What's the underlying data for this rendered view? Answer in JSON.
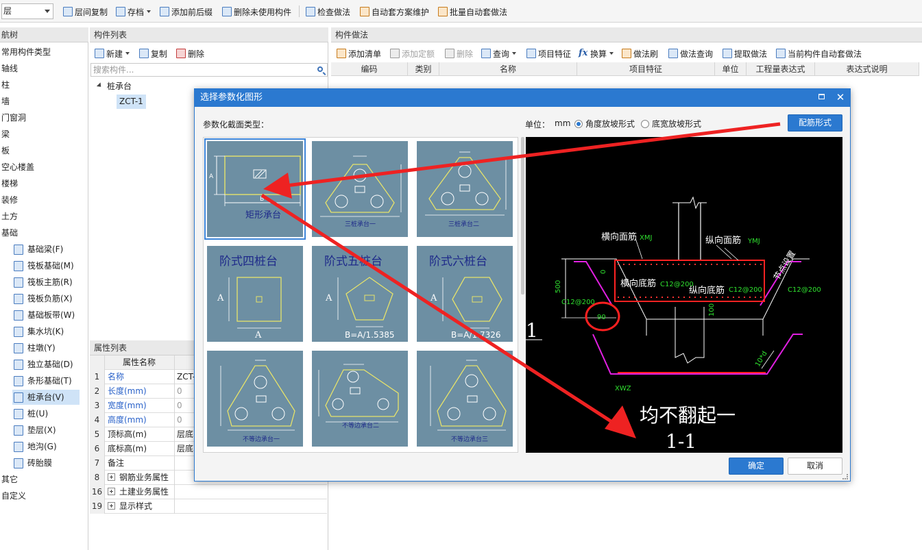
{
  "toolbar": {
    "floor": "层",
    "items": [
      "层间复制",
      "存档",
      "添加前后缀",
      "删除未使用构件",
      "检查做法",
      "自动套方案维护",
      "批量自动套做法"
    ]
  },
  "nav": {
    "title": "航树",
    "items": [
      "常用构件类型",
      "轴线",
      "柱",
      "墙",
      "门窗洞",
      "梁",
      "板",
      "空心楼盖",
      "楼梯",
      "装修",
      "土方",
      "基础"
    ],
    "sub_items": [
      "基础梁(F)",
      "筏板基础(M)",
      "筏板主筋(R)",
      "筏板负筋(X)",
      "基础板带(W)",
      "集水坑(K)",
      "柱墩(Y)",
      "独立基础(D)",
      "条形基础(T)",
      "桩承台(V)",
      "桩(U)",
      "垫层(X)",
      "地沟(G)",
      "砖胎膜"
    ],
    "bottom_items": [
      "其它",
      "自定义"
    ]
  },
  "complist": {
    "title": "构件列表",
    "new": "新建",
    "copy": "复制",
    "delete": "删除",
    "search_placeholder": "搜索构件...",
    "tree_root": "桩承台",
    "tree_child": "ZCT-1"
  },
  "props": {
    "title": "属性列表",
    "col_name": "属性名称",
    "rows": [
      {
        "num": "1",
        "name": "名称",
        "value": "ZCT-"
      },
      {
        "num": "2",
        "name": "长度(mm)",
        "value": "0"
      },
      {
        "num": "3",
        "name": "宽度(mm)",
        "value": "0"
      },
      {
        "num": "4",
        "name": "高度(mm)",
        "value": "0"
      },
      {
        "num": "5",
        "name": "顶标高(m)",
        "value": "层底"
      },
      {
        "num": "6",
        "name": "底标高(m)",
        "value": "层底"
      },
      {
        "num": "7",
        "name": "备注",
        "value": ""
      },
      {
        "num": "8",
        "name": "钢筋业务属性",
        "value": ""
      },
      {
        "num": "16",
        "name": "土建业务属性",
        "value": ""
      },
      {
        "num": "19",
        "name": "显示样式",
        "value": ""
      }
    ]
  },
  "method": {
    "title": "构件做法",
    "toolbar": [
      "添加清单",
      "添加定额",
      "删除",
      "查询",
      "项目特征",
      "换算",
      "做法刷",
      "做法查询",
      "提取做法",
      "当前构件自动套做法"
    ],
    "columns": [
      "编码",
      "类别",
      "名称",
      "项目特征",
      "单位",
      "工程量表达式",
      "表达式说明"
    ]
  },
  "dialog": {
    "title": "选择参数化图形",
    "section_label": "参数化截面类型：",
    "unit_label": "单位：",
    "unit_value": "mm",
    "radio_angle": "角度放坡形式",
    "radio_width": "底宽放坡形式",
    "rebar_button": "配筋形式",
    "ok": "确定",
    "cancel": "取消",
    "tiles": [
      {
        "label": "矩形承台",
        "kind": "rect"
      },
      {
        "label": "三桩承台一",
        "kind": "tri1"
      },
      {
        "label": "三桩承台二",
        "kind": "tri2"
      },
      {
        "label": "阶式四桩台",
        "kind": "sq"
      },
      {
        "label": "阶式五桩台",
        "kind": "pent"
      },
      {
        "label": "阶式六桩台",
        "kind": "hex"
      },
      {
        "label": "不等边承台一",
        "kind": "un1"
      },
      {
        "label": "不等边承台二",
        "kind": "un2"
      },
      {
        "label": "不等边承台三",
        "kind": "un3"
      }
    ],
    "tile_text": {
      "pent_formula": "B=A/1.5385",
      "hex_formula": "B=A/1.7326",
      "dim_a": "A",
      "dim_b": "B"
    },
    "preview": {
      "label_xmj": "横向面筋",
      "code_xmj": "XMJ",
      "label_ymj": "纵向面筋",
      "code_ymj": "YMJ",
      "label_xdj": "横向底筋",
      "code_xdj": "C12@200",
      "label_ydj": "纵向底筋",
      "code_ydj": "C12@200",
      "right_code": "C12@200",
      "left_code": "C12@200",
      "dim_500": "500",
      "dim_0": "0",
      "dim_100": "100",
      "angle": "90",
      "side_text": "节点设置",
      "dim_10d": "10*d",
      "code_xwz": "XWZ",
      "section_mark": "1",
      "note": "均不翻起一",
      "section_title": "1-1"
    }
  }
}
